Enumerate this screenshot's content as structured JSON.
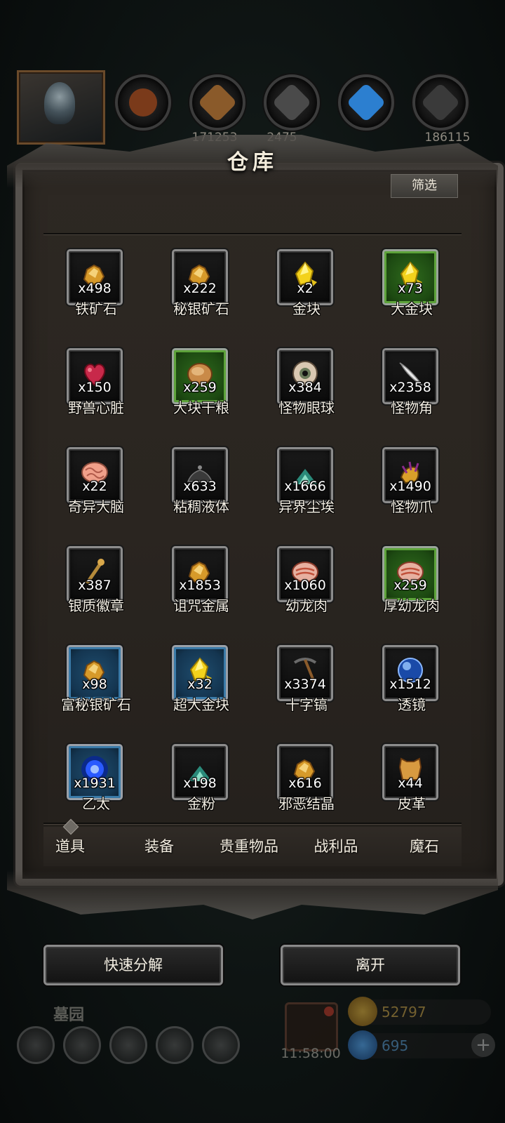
{
  "background": {
    "resources": [
      {
        "value": "",
        "icon": "leather-pouch-icon"
      },
      {
        "value": "171253",
        "icon": "wood-plank-icon"
      },
      {
        "value": "2475",
        "icon": "stone-brick-icon"
      },
      {
        "value": "",
        "icon": "blue-crystal-icon"
      },
      {
        "value": "186115",
        "icon": "iron-ingot-icon"
      }
    ],
    "area_name": "墓园",
    "timer": "11:58:00",
    "gold": "52797",
    "gems": "695"
  },
  "warehouse": {
    "title": "仓库",
    "filter_label": "筛选",
    "items": [
      {
        "name": "铁矿石",
        "qty": "x498",
        "icon": "ore-gold",
        "rarity": "normal"
      },
      {
        "name": "秘银矿石",
        "qty": "x222",
        "icon": "ore-gold",
        "rarity": "normal"
      },
      {
        "name": "金块",
        "qty": "x2",
        "icon": "gold-crystal",
        "rarity": "normal"
      },
      {
        "name": "大金块",
        "qty": "x73",
        "icon": "gold-crystal",
        "rarity": "green"
      },
      {
        "name": "野兽心脏",
        "qty": "x150",
        "icon": "heart",
        "rarity": "normal"
      },
      {
        "name": "大块干粮",
        "qty": "x259",
        "icon": "bread",
        "rarity": "green"
      },
      {
        "name": "怪物眼球",
        "qty": "x384",
        "icon": "eyeball",
        "rarity": "normal"
      },
      {
        "name": "怪物角",
        "qty": "x2358",
        "icon": "horn",
        "rarity": "normal"
      },
      {
        "name": "奇异大脑",
        "qty": "x22",
        "icon": "brain",
        "rarity": "normal"
      },
      {
        "name": "粘稠液体",
        "qty": "x633",
        "icon": "liquid",
        "rarity": "normal"
      },
      {
        "name": "异界尘埃",
        "qty": "x1666",
        "icon": "dust",
        "rarity": "normal"
      },
      {
        "name": "怪物爪",
        "qty": "x1490",
        "icon": "claw",
        "rarity": "normal"
      },
      {
        "name": "银质徽章",
        "qty": "x387",
        "icon": "badge",
        "rarity": "normal"
      },
      {
        "name": "诅咒金属",
        "qty": "x1853",
        "icon": "ore-gold",
        "rarity": "normal"
      },
      {
        "name": "幼龙肉",
        "qty": "x1060",
        "icon": "meat",
        "rarity": "normal"
      },
      {
        "name": "厚幼龙肉",
        "qty": "x259",
        "icon": "meat",
        "rarity": "green"
      },
      {
        "name": "富秘银矿石",
        "qty": "x98",
        "icon": "ore-gold",
        "rarity": "blue"
      },
      {
        "name": "超大金块",
        "qty": "x32",
        "icon": "gold-crystal",
        "rarity": "blue"
      },
      {
        "name": "十字镐",
        "qty": "x3374",
        "icon": "pickaxe",
        "rarity": "normal"
      },
      {
        "name": "透镜",
        "qty": "x1512",
        "icon": "lens",
        "rarity": "normal"
      },
      {
        "name": "乙太",
        "qty": "x1931",
        "icon": "ether",
        "rarity": "blue"
      },
      {
        "name": "金粉",
        "qty": "x198",
        "icon": "dust",
        "rarity": "normal"
      },
      {
        "name": "邪恶结晶",
        "qty": "x616",
        "icon": "ore-gold",
        "rarity": "normal"
      },
      {
        "name": "皮革",
        "qty": "x44",
        "icon": "leather",
        "rarity": "normal"
      }
    ],
    "tabs": [
      "道具",
      "装备",
      "贵重物品",
      "战利品",
      "魔石"
    ],
    "active_tab": "道具",
    "buttons": {
      "decompose": "快速分解",
      "leave": "离开"
    }
  },
  "colors": {
    "accent_green": "#3f8a22",
    "accent_blue": "#2b6c9a",
    "panel_bg": "#2a2520",
    "frame": "#56524e"
  }
}
